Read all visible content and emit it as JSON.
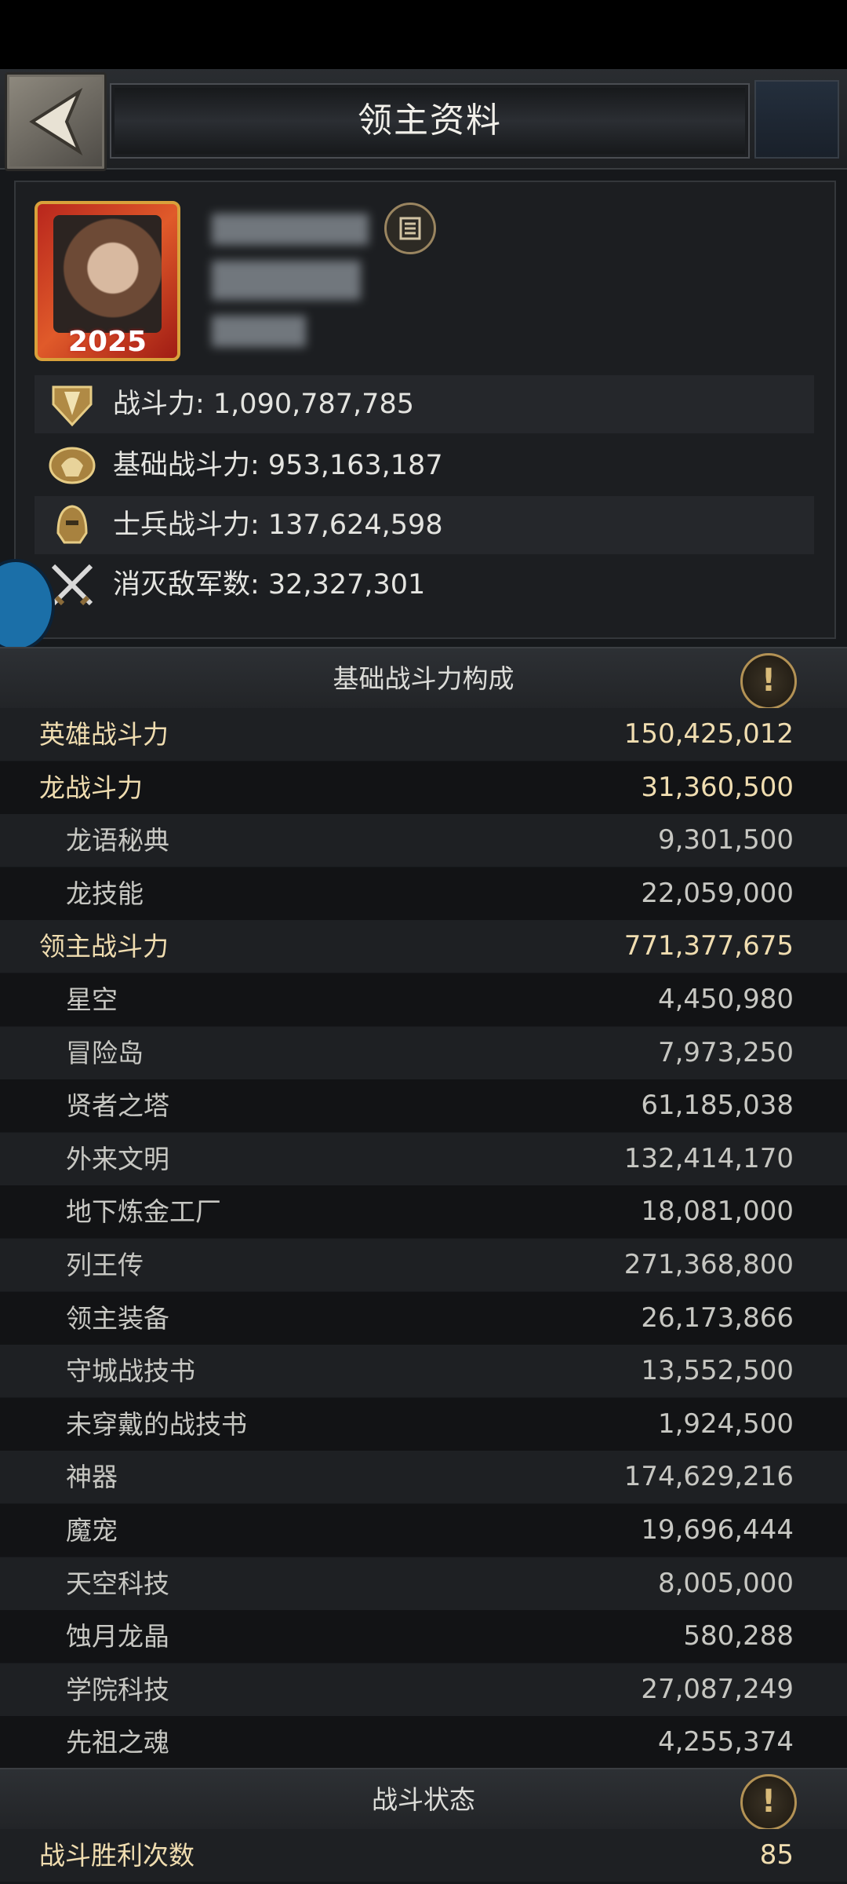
{
  "header": {
    "title": "领主资料"
  },
  "avatar": {
    "frame_year": "2025"
  },
  "stats": [
    {
      "icon": "shield-power-icon",
      "text": "战斗力: 1,090,787,785"
    },
    {
      "icon": "helmet-base-power-icon",
      "text": "基础战斗力: 953,163,187"
    },
    {
      "icon": "soldier-helmet-icon",
      "text": "士兵战斗力: 137,624,598"
    },
    {
      "icon": "crossed-swords-icon",
      "text": "消灭敌军数: 32,327,301"
    }
  ],
  "breakdown": {
    "title": "基础战斗力构成",
    "rows": [
      {
        "label": "英雄战斗力",
        "value": "150,425,012",
        "level": "primary"
      },
      {
        "label": "龙战斗力",
        "value": "31,360,500",
        "level": "primary"
      },
      {
        "label": "龙语秘典",
        "value": "9,301,500",
        "level": "sub"
      },
      {
        "label": "龙技能",
        "value": "22,059,000",
        "level": "sub"
      },
      {
        "label": "领主战斗力",
        "value": "771,377,675",
        "level": "primary"
      },
      {
        "label": "星空",
        "value": "4,450,980",
        "level": "sub"
      },
      {
        "label": "冒险岛",
        "value": "7,973,250",
        "level": "sub"
      },
      {
        "label": "贤者之塔",
        "value": "61,185,038",
        "level": "sub"
      },
      {
        "label": "外来文明",
        "value": "132,414,170",
        "level": "sub"
      },
      {
        "label": "地下炼金工厂",
        "value": "18,081,000",
        "level": "sub"
      },
      {
        "label": "列王传",
        "value": "271,368,800",
        "level": "sub"
      },
      {
        "label": "领主装备",
        "value": "26,173,866",
        "level": "sub"
      },
      {
        "label": "守城战技书",
        "value": "13,552,500",
        "level": "sub"
      },
      {
        "label": "未穿戴的战技书",
        "value": "1,924,500",
        "level": "sub"
      },
      {
        "label": "神器",
        "value": "174,629,216",
        "level": "sub"
      },
      {
        "label": "魔宠",
        "value": "19,696,444",
        "level": "sub"
      },
      {
        "label": "天空科技",
        "value": "8,005,000",
        "level": "sub"
      },
      {
        "label": "蚀月龙晶",
        "value": "580,288",
        "level": "sub"
      },
      {
        "label": "学院科技",
        "value": "27,087,249",
        "level": "sub"
      },
      {
        "label": "先祖之魂",
        "value": "4,255,374",
        "level": "sub"
      }
    ]
  },
  "battle_status": {
    "title": "战斗状态",
    "rows": [
      {
        "label": "战斗胜利次数",
        "value": "85",
        "level": "primary"
      }
    ]
  }
}
